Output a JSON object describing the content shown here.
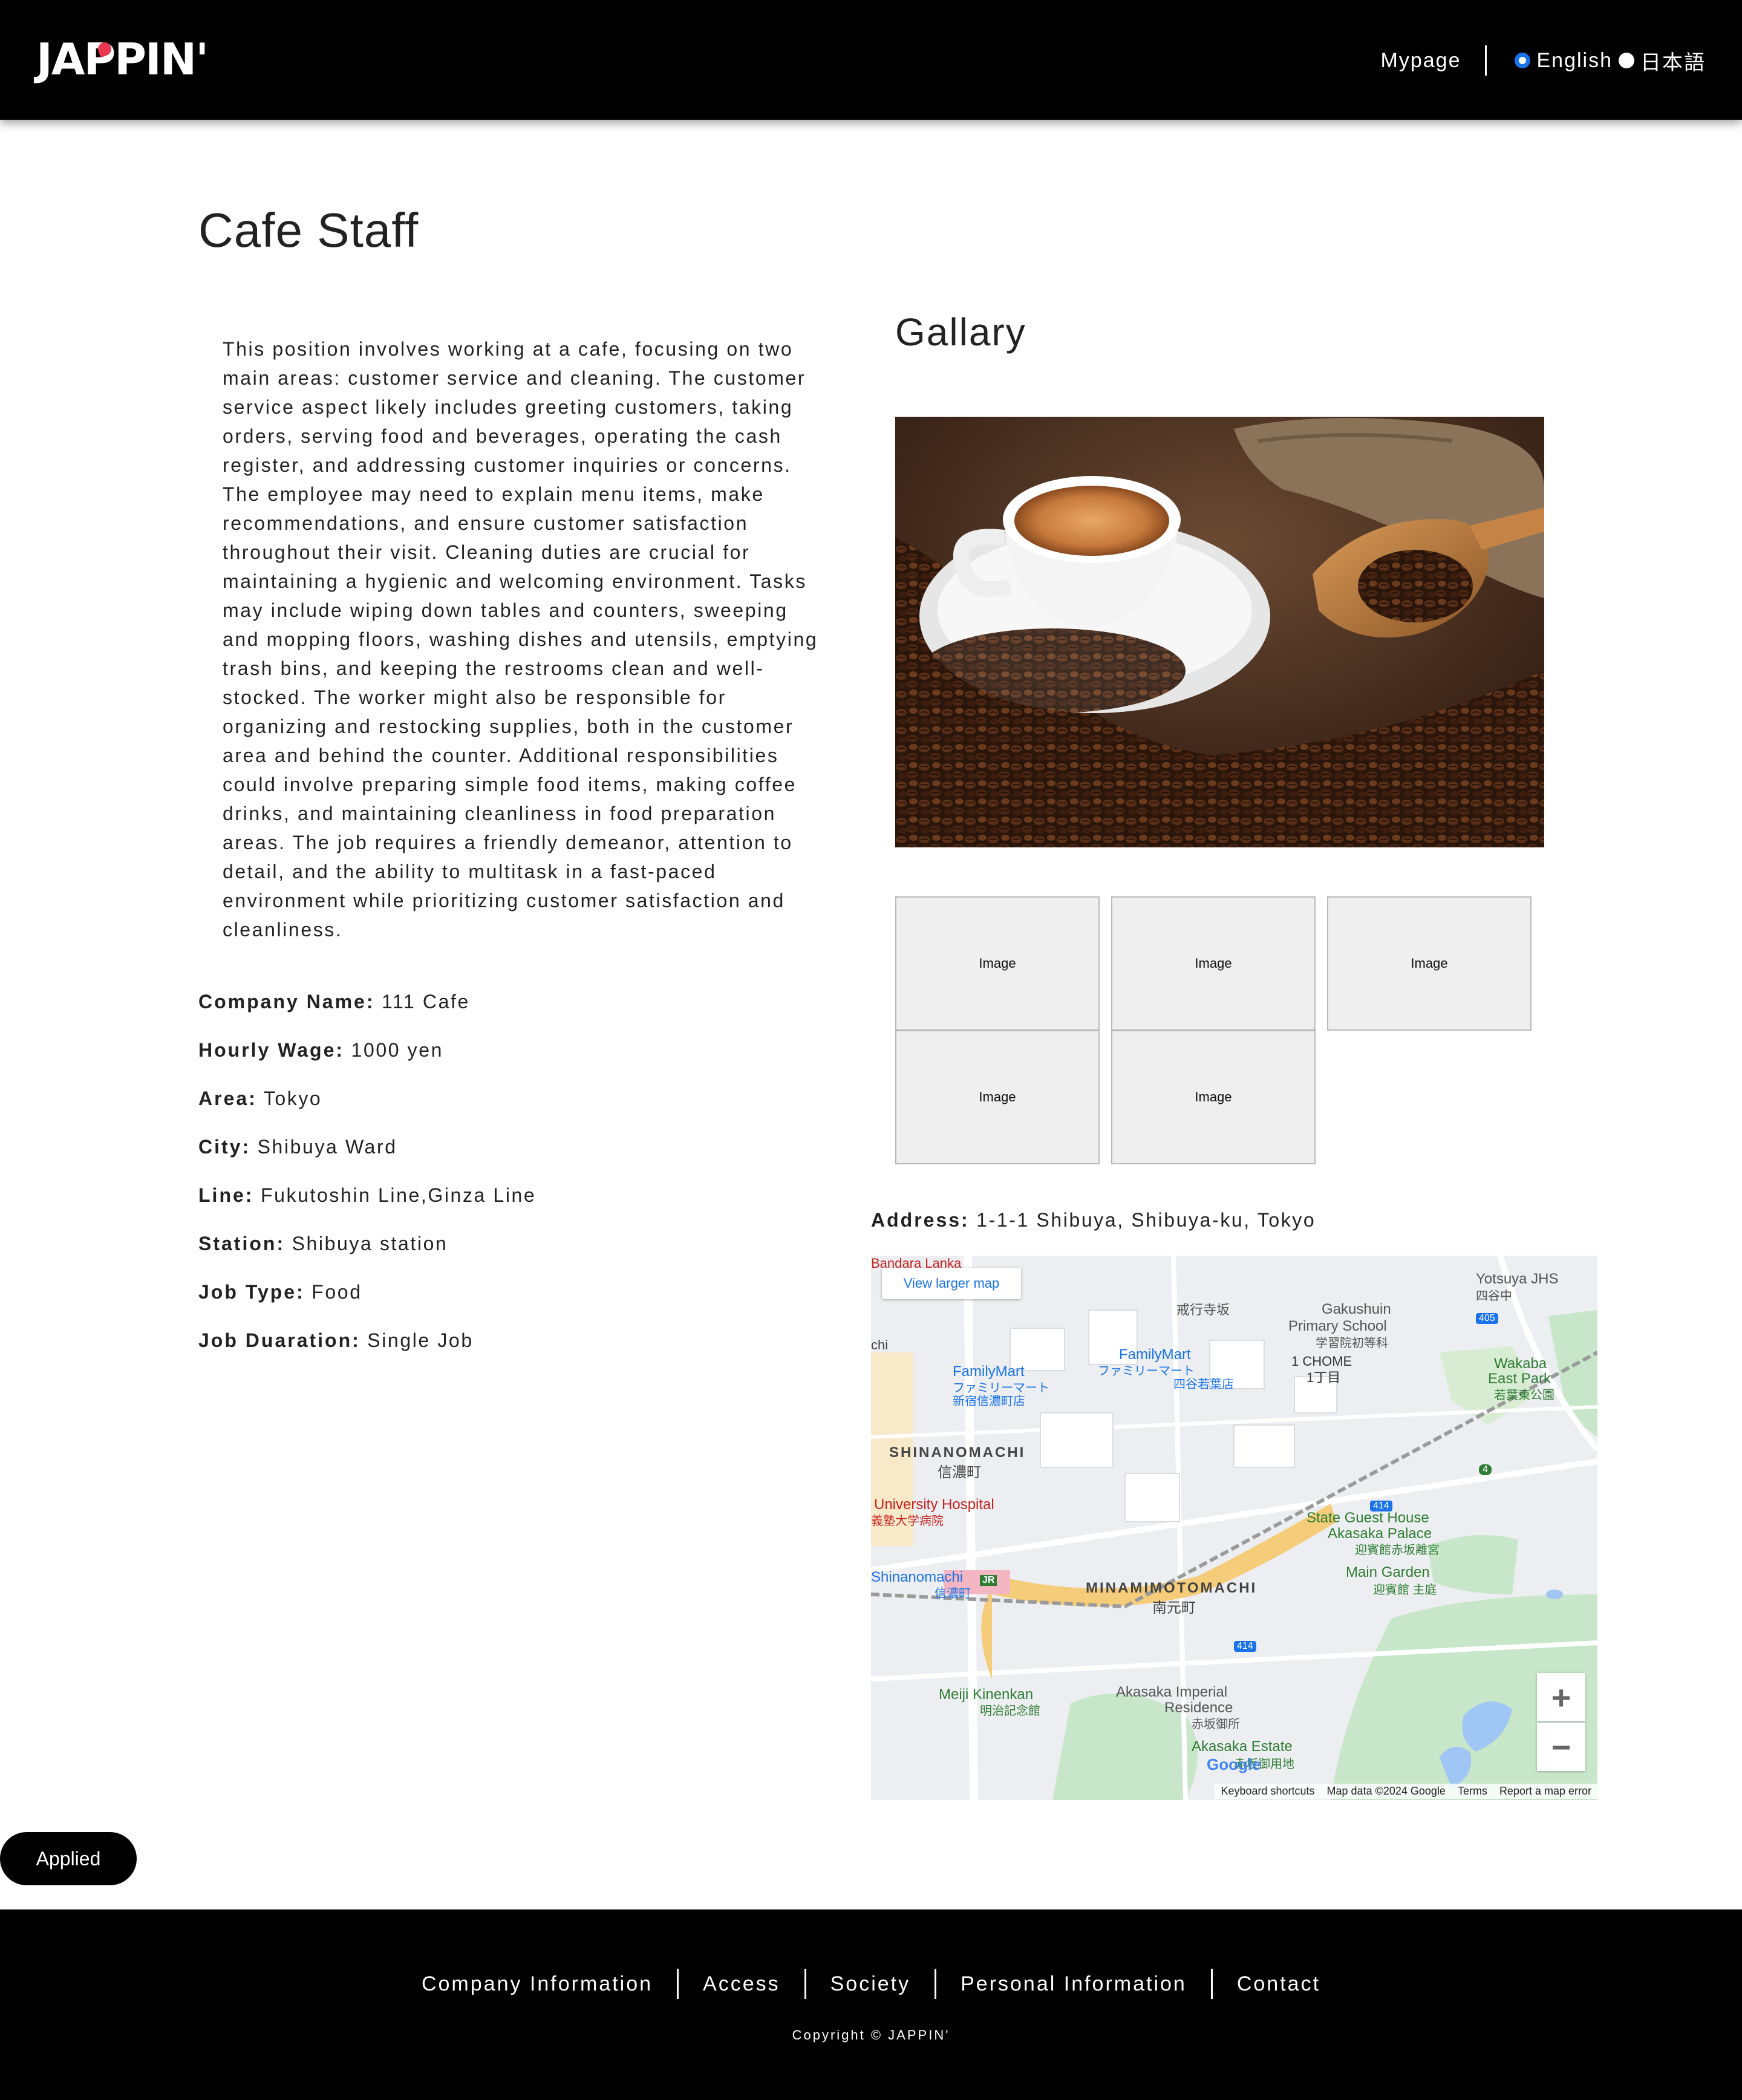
{
  "header": {
    "logo": "JAPPIN'",
    "mypage": "Mypage",
    "languages": [
      {
        "label": "English",
        "selected": true
      },
      {
        "label": "日本語",
        "selected": false
      }
    ]
  },
  "job": {
    "title": "Cafe Staff",
    "description": "This position involves working at a cafe, focusing on two main areas: customer service and cleaning. The customer service aspect likely includes greeting customers, taking orders, serving food and beverages, operating the cash register, and addressing customer inquiries or concerns. The employee may need to explain menu items, make recommendations, and ensure customer satisfaction throughout their visit. Cleaning duties are crucial for maintaining a hygienic and welcoming environment. Tasks may include wiping down tables and counters, sweeping and mopping floors, washing dishes and utensils, emptying trash bins, and keeping the restrooms clean and well-stocked. The worker might also be responsible for organizing and restocking supplies, both in the customer area and behind the counter. Additional responsibilities could involve preparing simple food items, making coffee drinks, and maintaining cleanliness in food preparation areas. The job requires a friendly demeanor, attention to detail, and the ability to multitask in a fast-paced environment while prioritizing customer satisfaction and cleanliness.",
    "details": [
      {
        "label": "Company Name:",
        "value": "111 Cafe"
      },
      {
        "label": "Hourly Wage:",
        "value": "1000 yen"
      },
      {
        "label": "Area:",
        "value": "Tokyo"
      },
      {
        "label": "City:",
        "value": "Shibuya Ward"
      },
      {
        "label": "Line:",
        "value": "Fukutoshin Line,Ginza Line"
      },
      {
        "label": "Station:",
        "value": "Shibuya station"
      },
      {
        "label": "Job Type:",
        "value": "Food"
      },
      {
        "label": "Job Duaration:",
        "value": "Single Job"
      }
    ]
  },
  "gallery": {
    "title": "Gallary",
    "thumbnails": [
      "Image",
      "Image",
      "Image",
      "Image",
      "Image"
    ]
  },
  "address": {
    "label": "Address:",
    "value": "1-1-1 Shibuya, Shibuya-ku, Tokyo"
  },
  "map": {
    "view_larger": "View larger map",
    "zoom_in": "+",
    "zoom_out": "−",
    "footer": [
      "Keyboard shortcuts",
      "Map data ©2024 Google",
      "Terms",
      "Report a map error"
    ],
    "labels": {
      "bandara": "Bandara Lanka",
      "familymart1": "FamilyMart",
      "familymart1_jp": "ファミリーマート",
      "familymart1_jp2": "新宿信濃町店",
      "familymart2": "FamilyMart",
      "familymart2_jp": "ファミリーマート",
      "familymart2_jp2": "四谷若葉店",
      "kairyoji": "戒行寺坂",
      "gakushuin": "Gakushuin",
      "gakushuin2": "Primary School",
      "gakushuin_jp": "学習院初等科",
      "chome": "1 CHOME",
      "chome_jp": "1丁目",
      "yotsuya": "Yotsuya JHS",
      "yotsuya_jp": "四谷中",
      "wakaba": "Wakaba",
      "wakaba2": "East Park",
      "wakaba_jp": "若葉東公園",
      "shinanomachi": "SHINANOMACHI",
      "shinanomachi_jp": "信濃町",
      "hospital": "University Hospital",
      "hospital_jp": "義塾大学病院",
      "station": "Shinanomachi",
      "station_jp": "信濃町",
      "minamimoto": "MINAMIMOTOMACHI",
      "minamimoto_jp": "南元町",
      "guesthouse": "State Guest House",
      "guesthouse2": "Akasaka Palace",
      "guesthouse_jp": "迎賓館赤坂離宮",
      "maingarden": "Main Garden",
      "maingarden_jp": "迎賓館 主庭",
      "meiji": "Meiji Kinenkan",
      "meiji_jp": "明治記念館",
      "akasaka": "Akasaka Imperial",
      "akasaka2": "Residence",
      "akasaka_jp": "赤坂御所",
      "estate": "Akasaka Estate",
      "estate_jp": "赤坂御用地",
      "google": "Google",
      "r405": "405",
      "r414a": "414",
      "r414b": "414",
      "r4": "4",
      "chi": "chi",
      "jr": "JR"
    }
  },
  "applied_button": "Applied",
  "footer": {
    "links": [
      "Company Information",
      "Access",
      "Society",
      "Personal Information",
      "Contact"
    ],
    "copyright": "Copyright © JAPPIN'"
  }
}
